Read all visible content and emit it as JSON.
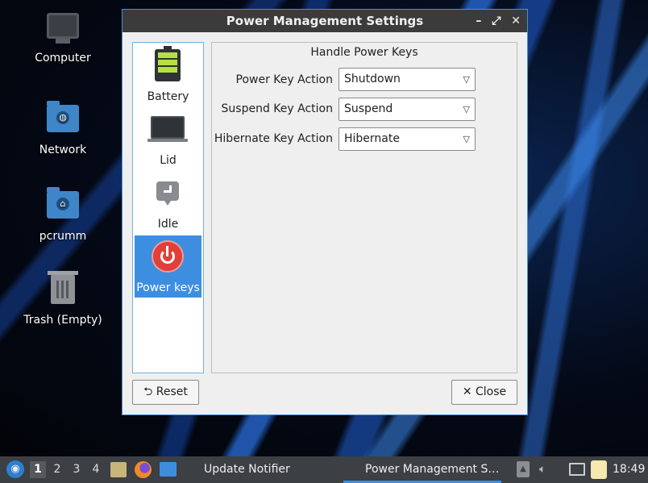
{
  "desktop": {
    "icons": [
      {
        "label": "Computer",
        "icon": "computer-icon"
      },
      {
        "label": "Network",
        "icon": "network-folder-icon"
      },
      {
        "label": "pcrumm",
        "icon": "home-folder-icon"
      },
      {
        "label": "Trash (Empty)",
        "icon": "trash-icon"
      }
    ]
  },
  "window": {
    "title": "Power Management Settings",
    "controls": {
      "minimize": "–",
      "maximize": "⤢",
      "close": "✕"
    },
    "sidebar": {
      "items": [
        {
          "label": "Battery",
          "icon": "battery-icon"
        },
        {
          "label": "Lid",
          "icon": "laptop-icon"
        },
        {
          "label": "Idle",
          "icon": "idle-icon"
        },
        {
          "label": "Power keys",
          "icon": "power-icon",
          "selected": true
        }
      ]
    },
    "panel": {
      "title": "Handle Power Keys",
      "rows": [
        {
          "label": "Power Key Action",
          "value": "Shutdown"
        },
        {
          "label": "Suspend Key Action",
          "value": "Suspend"
        },
        {
          "label": "Hibernate Key Action",
          "value": "Hibernate"
        }
      ]
    },
    "buttons": {
      "reset": {
        "icon": "⮌",
        "label": "Reset"
      },
      "close": {
        "icon": "✕",
        "label": "Close"
      }
    }
  },
  "taskbar": {
    "workspaces": [
      "1",
      "2",
      "3",
      "4"
    ],
    "active_workspace": "1",
    "tasks": [
      "Update Notifier",
      "Power Management S…"
    ],
    "clock": "18:49"
  },
  "colors": {
    "accent": "#3d8ee0",
    "titlebar": "#3b3b3b",
    "taskbar": "#3c3f43",
    "power_icon": "#e0403a",
    "battery_fill": "#b6e043"
  }
}
